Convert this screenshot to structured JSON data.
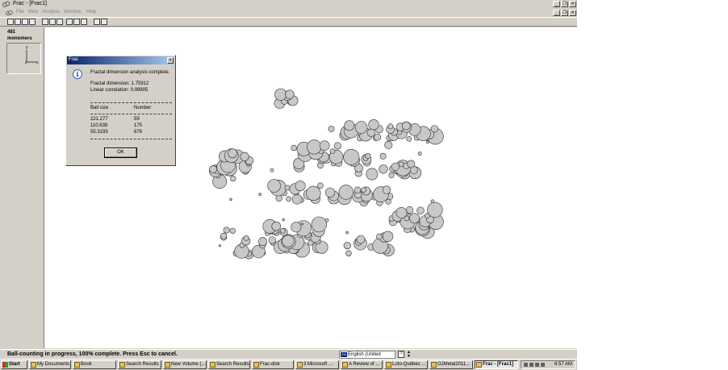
{
  "window": {
    "title": "Frac - [Frac1]",
    "icon": "frac-app-icon",
    "buttons": [
      "minimize-icon",
      "restore-icon",
      "close-icon"
    ]
  },
  "menu": {
    "items": [
      "File",
      "View",
      "Analysis",
      "Window",
      "Help"
    ]
  },
  "toolbar": {
    "icons": [
      "new-icon",
      "open-icon",
      "save-icon",
      "print-icon",
      "cut-icon",
      "copy-icon",
      "paste-icon",
      "zoom-icon",
      "analyze-icon",
      "info-icon",
      "help-icon"
    ]
  },
  "sidebar": {
    "count": "481",
    "unit": "monomers",
    "axes": {
      "y": "y",
      "z": "z",
      "x": "x"
    }
  },
  "dialog": {
    "title": "Frac",
    "message": "Fractal dimension analysis complete.",
    "fractal_dimension": "Fractal dimension: 1.75912",
    "linear_correlation": "Linear correlation: 0.99805",
    "columns": [
      "Ball size",
      "Number"
    ],
    "rows": [
      {
        "size": "221.277",
        "number": "59"
      },
      {
        "size": "110.639",
        "number": "175"
      },
      {
        "size": "55.3193",
        "number": "676"
      }
    ],
    "ok_label": "OK"
  },
  "status": {
    "text": "Ball-counting in progress, 100% complete. Press Esc to cancel.",
    "language_code": "EN",
    "language": "English (United States)"
  },
  "taskbar": {
    "start_label": "Start",
    "tasks": [
      "My Documents",
      "Book",
      "Search Results",
      "New Volume (...",
      "Search Results",
      "Frac-disk",
      "3 Microsoft ...",
      "A Review of ...",
      "Loto-Québec ...",
      "OJMetal2011...",
      "Frac - [Frac1]"
    ],
    "active_task": 10,
    "clock": "6:57 AM"
  },
  "colors": {
    "window_face": "#d4d0c8",
    "title_gradient_start": "#0a246a",
    "title_gradient_end": "#a6caf0",
    "sphere_fill": "#c8c8c8",
    "sphere_stroke": "#303030"
  }
}
